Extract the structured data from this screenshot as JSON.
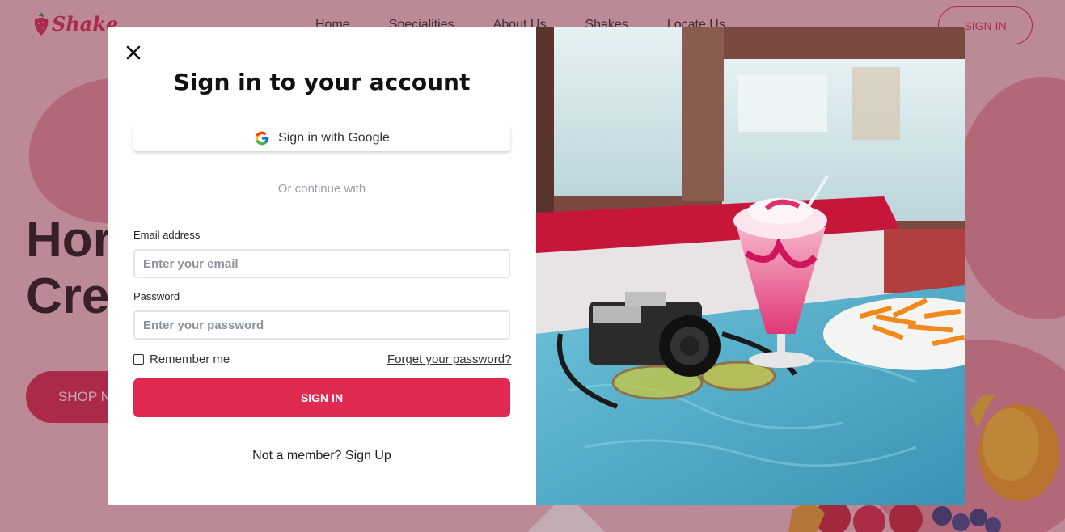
{
  "brand": {
    "name": "Shake"
  },
  "nav": {
    "items": [
      "Home",
      "Specialities",
      "About Us",
      "Shakes",
      "Locate Us"
    ]
  },
  "header": {
    "signin_label": "SIGN IN"
  },
  "hero": {
    "line1": "Hor",
    "line2": "Crea",
    "cta_label": "SHOP N"
  },
  "modal": {
    "title": "Sign in to your account",
    "google_label": "Sign in with Google",
    "divider_text": "Or continue with",
    "email": {
      "label": "Email address",
      "placeholder": "Enter your email",
      "value": ""
    },
    "password": {
      "label": "Password",
      "placeholder": "Enter your password",
      "value": ""
    },
    "remember_label": "Remember me",
    "remember_checked": false,
    "forgot_label": "Forget your password?",
    "submit_label": "SIGN IN",
    "member_text": "Not a member?",
    "signup_label": "Sign Up"
  },
  "colors": {
    "accent": "#e02a51",
    "brand": "#d8224a",
    "page_bg": "#f3c6d0"
  },
  "icons": {
    "close": "close-icon",
    "google": "google-icon",
    "logo": "strawberry-icon"
  }
}
